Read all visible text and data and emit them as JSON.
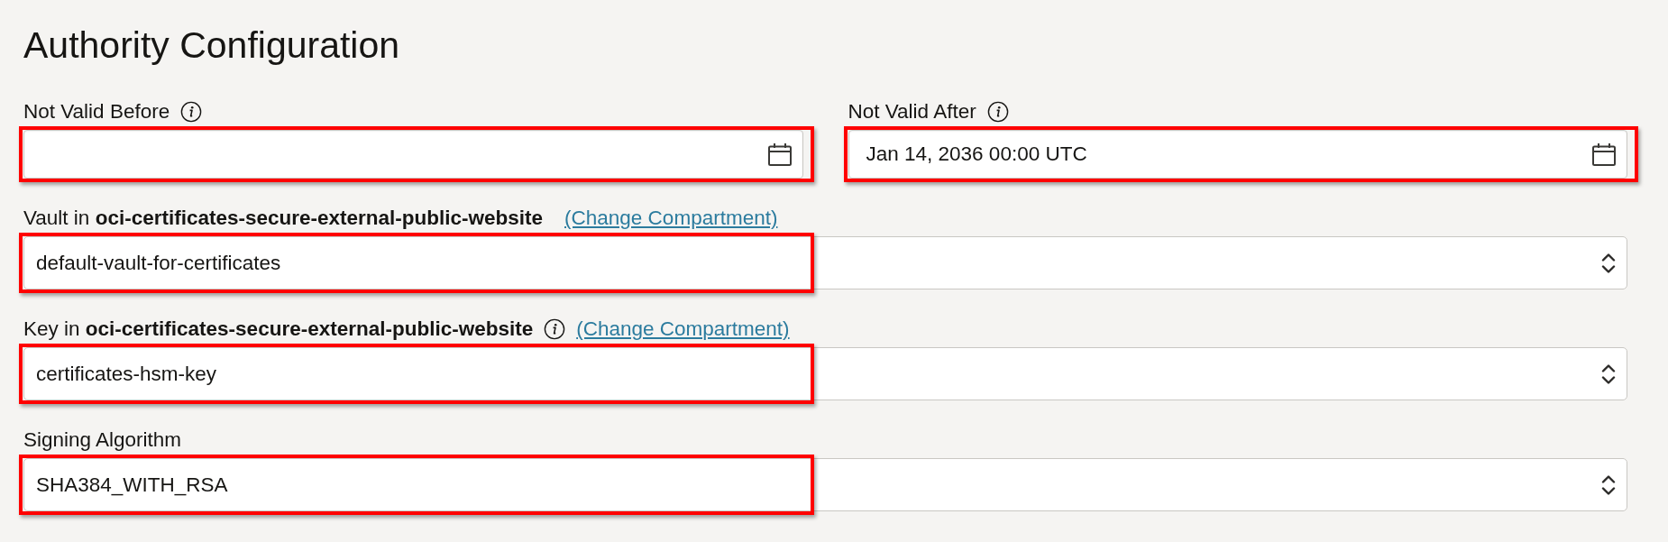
{
  "title": "Authority Configuration",
  "date_fields": [
    {
      "label": "Not Valid Before",
      "info_icon": true,
      "highlighted": true
    },
    {
      "label": "Not Valid After",
      "info_icon": true,
      "value": "Jan 14, 2036 00:00 UTC",
      "highlighted": true
    }
  ],
  "select_fields": [
    {
      "label": "Vault in **oci-certificates-secure-external-public-website**",
      "info_icon": false,
      "link": "(Change Compartment)",
      "value": "default-vault-for-certificates",
      "highlighted": true
    },
    {
      "label": "Key in **oci-certificates-secure-external-public-website**",
      "info_icon": true,
      "link": "(Change Compartment)",
      "value": "certificates-hsm-key",
      "highlighted": true
    },
    {
      "label": "Signing Algorithm",
      "info_icon": false,
      "value": "SHA384_WITH_RSA",
      "highlighted": true
    }
  ]
}
